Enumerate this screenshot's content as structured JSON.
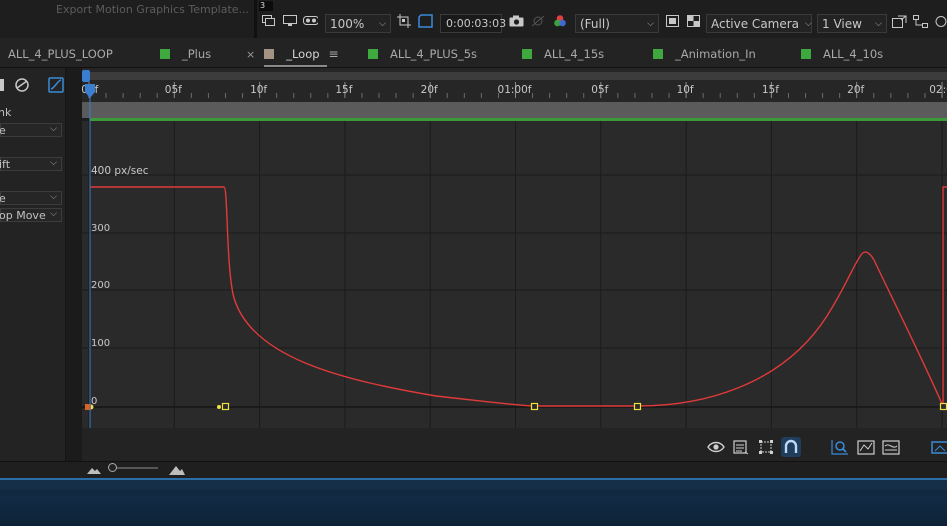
{
  "top": {
    "ghost_title": "Export Motion Graphics Template...",
    "mini_value": "3",
    "zoom": "100%",
    "timecode": "0:00:03:03",
    "resolution": "(Full)",
    "camera": "Active Camera",
    "views": "1 View"
  },
  "tabs": [
    {
      "label": "ALL_4_PLUS_LOOP",
      "color": null,
      "active": false
    },
    {
      "label": "_Plus",
      "color": "#3fa93f",
      "active": false
    },
    {
      "label": "_Loop",
      "color": "#a39384",
      "active": true
    },
    {
      "label": "ALL_4_PLUS_5s",
      "color": "#3fa93f",
      "active": false
    },
    {
      "label": "ALL_4_15s",
      "color": "#3fa93f",
      "active": false
    },
    {
      "label": "_Animation_In",
      "color": "#3fa93f",
      "active": false
    },
    {
      "label": "ALL_4_10s",
      "color": "#3fa93f",
      "active": false
    }
  ],
  "left_panel": {
    "rows": [
      "nk",
      "e",
      "ift",
      "e",
      "op Move"
    ]
  },
  "graph": {
    "unit_label": "400 px/sec",
    "ruler_ticks": [
      ":00f",
      "05f",
      "10f",
      "15f",
      "20f",
      "01:00f",
      "05f",
      "10f",
      "15f",
      "20f",
      "02:0"
    ],
    "y_ticks": [
      "300",
      "200",
      "100",
      "0"
    ],
    "curve_color": "#e03a3a",
    "keyframe_color": "#f0e040",
    "playhead_color": "#3a7fcf"
  },
  "icons": {
    "graph_bottom": [
      "eye-icon",
      "graph-type-icon",
      "transform-box-icon",
      "snap-icon",
      "fit-selection-icon",
      "fit-all-icon",
      "edit-ease-icon",
      "composition-icon"
    ]
  }
}
